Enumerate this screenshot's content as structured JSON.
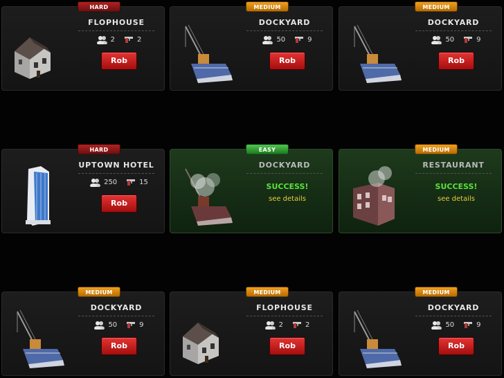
{
  "jobs": [
    {
      "difficulty": "HARD",
      "level": "hard",
      "name": "FLOPHOUSE",
      "art": "house",
      "crew": "2",
      "weapons": "2",
      "rob_label": "Rob"
    },
    {
      "difficulty": "MEDIUM",
      "level": "medium",
      "name": "DOCKYARD",
      "art": "crane",
      "crew": "50",
      "weapons": "9",
      "rob_label": "Rob"
    },
    {
      "difficulty": "MEDIUM",
      "level": "medium",
      "name": "DOCKYARD",
      "art": "crane",
      "crew": "50",
      "weapons": "9",
      "rob_label": "Rob"
    },
    {
      "difficulty": "HARD",
      "level": "hard",
      "name": "UPTOWN HOTEL",
      "art": "tower",
      "crew": "250",
      "weapons": "15",
      "rob_label": "Rob"
    },
    {
      "difficulty": "EASY",
      "level": "easy",
      "name": "DOCKYARD",
      "art": "crane-smoke",
      "status": "SUCCESS!",
      "details_label": "see details"
    },
    {
      "difficulty": "MEDIUM",
      "level": "medium",
      "name": "RESTAURANT",
      "art": "restaurant-smoke",
      "status": "SUCCESS!",
      "details_label": "see details"
    },
    {
      "difficulty": "MEDIUM",
      "level": "medium",
      "name": "DOCKYARD",
      "art": "crane",
      "crew": "50",
      "weapons": "9",
      "rob_label": "Rob"
    },
    {
      "difficulty": "MEDIUM",
      "level": "medium",
      "name": "FLOPHOUSE",
      "art": "house",
      "crew": "2",
      "weapons": "2",
      "rob_label": "Rob"
    },
    {
      "difficulty": "MEDIUM",
      "level": "medium",
      "name": "DOCKYARD",
      "art": "crane",
      "crew": "50",
      "weapons": "9",
      "rob_label": "Rob"
    }
  ]
}
